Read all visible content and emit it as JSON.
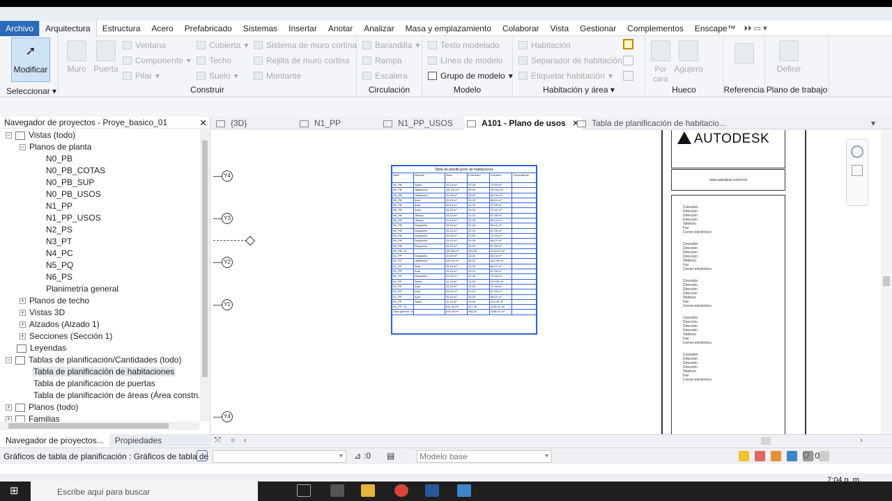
{
  "menubar": {
    "tabs": [
      "Archivo",
      "Arquitectura",
      "Estructura",
      "Acero",
      "Prefabricado",
      "Sistemas",
      "Insertar",
      "Anotar",
      "Analizar",
      "Masa y emplazamiento",
      "Colaborar",
      "Vista",
      "Gestionar",
      "Complementos",
      "Enscape™"
    ],
    "active": "Arquitectura"
  },
  "ribbon": {
    "select": {
      "modify": "Modificar",
      "select": "Seleccionar"
    },
    "construir": {
      "label": "Construir",
      "muro": "Muro",
      "puerta": "Puerta",
      "ventana": "Ventana",
      "componente": "Componente",
      "pilar": "Pilar",
      "cubierta": "Cubierta",
      "techo": "Techo",
      "suelo": "Suelo",
      "sistema_muro": "Sistema de muro cortina",
      "rejilla_muro": "Rejilla de muro cortina",
      "montante": "Montante"
    },
    "circulacion": {
      "label": "Circulación",
      "barandilla": "Barandilla",
      "rampa": "Rampa",
      "escalera": "Escalera"
    },
    "modelo": {
      "label": "Modelo",
      "texto": "Texto modelado",
      "linea": "Línea de modelo",
      "grupo": "Grupo de modelo"
    },
    "habitacion": {
      "label": "Habitación y área",
      "habitacion": "Habitación",
      "separador": "Separador de habitación",
      "etiquetar": "Etiquetar habitación"
    },
    "hueco": {
      "label": "Hueco",
      "por_cara": "Por cara",
      "agujero": "Agujero"
    },
    "referencia": {
      "label": "Referencia"
    },
    "plano_trabajo": {
      "label": "Plano de trabajo",
      "definir": "Definir"
    }
  },
  "browser": {
    "title": "Navegador de proyectos - Proye_basico_01",
    "nodes": [
      "Vistas (todo)",
      "Planos de planta",
      "N0_PB",
      "N0_PB_COTAS",
      "N0_PB_SUP",
      "N0_PB_USOS",
      "N1_PP",
      "N1_PP_USOS",
      "N2_PS",
      "N3_PT",
      "N4_PC",
      "N5_PQ",
      "N6_PS",
      "Planimetría general",
      "Planos de techo",
      "Vistas 3D",
      "Alzados (Alzado 1)",
      "Secciones (Sección 1)",
      "Leyendas",
      "Tablas de planificación/Cantidades (todo)",
      "Tabla de planificación de habitaciones",
      "Tabla de planificación de puertas",
      "Tabla de planificación de áreas (Área construida",
      "Planos (todo)",
      "Familias"
    ],
    "tabs": [
      "Navegador de proyectos...",
      "Propiedades"
    ]
  },
  "doctabs": [
    "{3D}",
    "N1_PP",
    "N1_PP_USOS",
    "A101 - Plano de usos",
    "Tabla de planificación de habitacio..."
  ],
  "grid": [
    "Y4",
    "Y3",
    "Y2",
    "Y1",
    "Y4"
  ],
  "schedule": {
    "title": "Tabla de planificación de habitaciones",
    "headers": [
      "Nivel",
      "Nombre",
      "Área",
      "Perímetro",
      "Volumen",
      "Comentarios"
    ],
    "rows": [
      [
        "N0_PB",
        "Salon",
        "25.23 m²",
        "20.25",
        "70.30 m³",
        ""
      ],
      [
        "N0_PB",
        "Habitación",
        "162.00 m²",
        "59.20",
        "443.16 m³",
        ""
      ],
      [
        "N0_PB",
        "Habitación",
        "20.25 m²",
        "18.00",
        "56.16 m³",
        ""
      ],
      [
        "N0_PB",
        "Aula",
        "25.19 m²",
        "20.25",
        "68.01 m³",
        ""
      ],
      [
        "N0_PB",
        "Aula",
        "25.22 m²",
        "20.10",
        "67.55 m³",
        ""
      ],
      [
        "N0_PB",
        "Aula",
        "25.23 m²",
        "20.25",
        "70.30 m³",
        ""
      ],
      [
        "N0_PB",
        "Oficina",
        "25.22 m²",
        "20.10",
        "67.55 m³",
        ""
      ],
      [
        "N0_PB",
        "Oficina",
        "25.19 m²",
        "20.25",
        "68.01 m³",
        ""
      ],
      [
        "N0_PB",
        "Despacho",
        "25.19 m²",
        "20.25",
        "68.01 m³",
        ""
      ],
      [
        "N0_PB",
        "Despacho",
        "25.22 m²",
        "20.10",
        "67.55 m³",
        ""
      ],
      [
        "N0_PB",
        "Despacho",
        "25.23 m²",
        "20.25",
        "70.30 m³",
        ""
      ],
      [
        "N0_PB",
        "Despacho",
        "25.19 m²",
        "20.25",
        "68.01 m³",
        ""
      ],
      [
        "N0_PB",
        "Despacho",
        "25.22 m²",
        "20.10",
        "67.55 m³",
        ""
      ],
      [
        "N0_PB: 14",
        "",
        "432.56 m²",
        "251.40",
        "1224.20 m³",
        ""
      ],
      [
        "N1_PP",
        "Despacho",
        "20.20 m²",
        "18.40",
        "56.16 m³",
        ""
      ],
      [
        "N1_PP",
        "Habitación",
        "162.00 m²",
        "59.20",
        "443.16 m³",
        ""
      ],
      [
        "N1_PP",
        "Aula",
        "25.19 m²",
        "20.25",
        "68.01 m³",
        ""
      ],
      [
        "N1_PP",
        "Aula",
        "25.22 m²",
        "20.10",
        "67.55 m³",
        ""
      ],
      [
        "N1_PP",
        "Despacho",
        "25.23 m²",
        "20.25",
        "70.30 m³",
        ""
      ],
      [
        "N1_PP",
        "Salon",
        "11.78 m²",
        "14.00",
        "229.35 m³",
        ""
      ],
      [
        "N1_PP",
        "Aula",
        "25.23 m²",
        "20.25",
        "70.30 m³",
        ""
      ],
      [
        "N1_PP",
        "Aula",
        "25.22 m²",
        "20.10",
        "67.55 m³",
        ""
      ],
      [
        "N1_PP",
        "Aula",
        "25.19 m²",
        "20.25",
        "68.01 m³",
        ""
      ],
      [
        "N1_PP",
        "Salon",
        "11.78 m²",
        "14.00",
        "229.35 m³",
        ""
      ],
      [
        "N1_PP: 10",
        "",
        "431.20 m²",
        "317.40",
        "1332.00 m³",
        ""
      ],
      [
        "Total general: 24",
        "",
        "878.78 m²",
        "565.20",
        "2556.20 m³",
        ""
      ]
    ]
  },
  "titleblock": {
    "brand": "AUTODESK",
    "web": "www.autodesk.com/revit",
    "contact_lines": [
      "Consultor",
      "Dirección",
      "Dirección",
      "Dirección",
      "Teléfono",
      "Fax",
      "Correo electrónico"
    ]
  },
  "statusbar": {
    "text": "Gráficos de tabla de planificación : Gráficos de tabla de",
    "zero1": ":0",
    "model": "Modelo base",
    "zero2": ":0"
  },
  "taskbar": {
    "search": "Escribe aquí para buscar",
    "time": "7:04 p. m."
  },
  "colors": {
    "file_tab": "#2a6ab8",
    "schedule_border": "#2d5fd8",
    "modify_bg": "#cfe3f7"
  }
}
